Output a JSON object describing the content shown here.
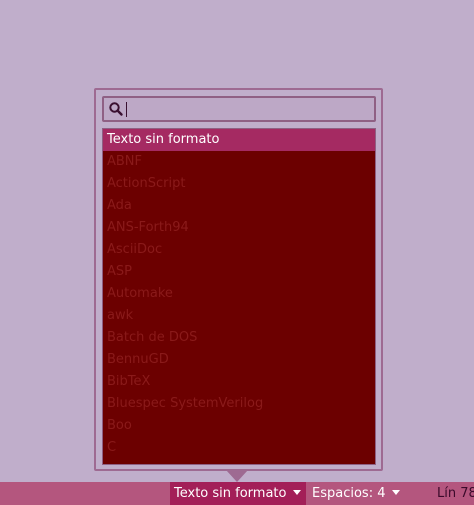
{
  "language_popover": {
    "search": {
      "value": "",
      "placeholder": ""
    },
    "items": [
      {
        "label": "Texto sin formato",
        "selected": true
      },
      {
        "label": "ABNF"
      },
      {
        "label": "ActionScript"
      },
      {
        "label": "Ada"
      },
      {
        "label": "ANS-Forth94"
      },
      {
        "label": "AsciiDoc"
      },
      {
        "label": "ASP"
      },
      {
        "label": "Automake"
      },
      {
        "label": "awk"
      },
      {
        "label": "Batch de DOS"
      },
      {
        "label": "BennuGD"
      },
      {
        "label": "BibTeX"
      },
      {
        "label": "Bluespec SystemVerilog"
      },
      {
        "label": "Boo"
      },
      {
        "label": "C"
      }
    ]
  },
  "statusbar": {
    "language_label": "Texto sin formato",
    "spaces_label": "Espacios: 4",
    "line_label": "Lín 78"
  },
  "colors": {
    "background": "#c0aecb",
    "list_background": "#6c0000",
    "selected_row": "#a52a62",
    "statusbar": "#b4567e",
    "statusbar_active": "#a31f58"
  }
}
